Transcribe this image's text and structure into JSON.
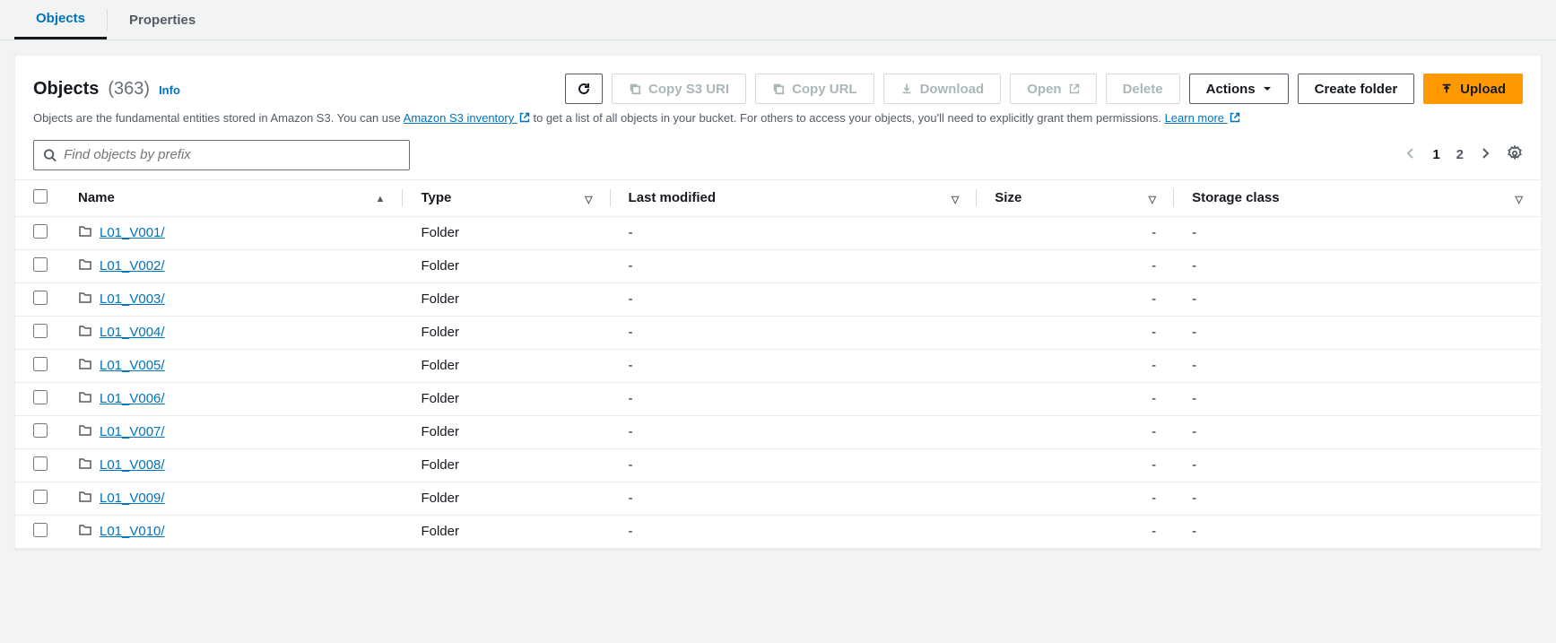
{
  "tabs": {
    "objects": "Objects",
    "properties": "Properties"
  },
  "header": {
    "title": "Objects",
    "count": "(363)",
    "info": "Info"
  },
  "toolbar": {
    "copy_s3_uri": "Copy S3 URI",
    "copy_url": "Copy URL",
    "download": "Download",
    "open": "Open",
    "delete": "Delete",
    "actions": "Actions",
    "create_folder": "Create folder",
    "upload": "Upload"
  },
  "description": {
    "pre": "Objects are the fundamental entities stored in Amazon S3. You can use ",
    "link1": "Amazon S3 inventory",
    "mid": " to get a list of all objects in your bucket. For others to access your objects, you'll need to explicitly grant them permissions. ",
    "link2": "Learn more"
  },
  "search": {
    "placeholder": "Find objects by prefix"
  },
  "pagination": {
    "page1": "1",
    "page2": "2"
  },
  "columns": {
    "name": "Name",
    "type": "Type",
    "last_modified": "Last modified",
    "size": "Size",
    "storage_class": "Storage class"
  },
  "rows": [
    {
      "name": "L01_V001/",
      "type": "Folder",
      "last_modified": "-",
      "size": "-",
      "storage_class": "-"
    },
    {
      "name": "L01_V002/",
      "type": "Folder",
      "last_modified": "-",
      "size": "-",
      "storage_class": "-"
    },
    {
      "name": "L01_V003/",
      "type": "Folder",
      "last_modified": "-",
      "size": "-",
      "storage_class": "-"
    },
    {
      "name": "L01_V004/",
      "type": "Folder",
      "last_modified": "-",
      "size": "-",
      "storage_class": "-"
    },
    {
      "name": "L01_V005/",
      "type": "Folder",
      "last_modified": "-",
      "size": "-",
      "storage_class": "-"
    },
    {
      "name": "L01_V006/",
      "type": "Folder",
      "last_modified": "-",
      "size": "-",
      "storage_class": "-"
    },
    {
      "name": "L01_V007/",
      "type": "Folder",
      "last_modified": "-",
      "size": "-",
      "storage_class": "-"
    },
    {
      "name": "L01_V008/",
      "type": "Folder",
      "last_modified": "-",
      "size": "-",
      "storage_class": "-"
    },
    {
      "name": "L01_V009/",
      "type": "Folder",
      "last_modified": "-",
      "size": "-",
      "storage_class": "-"
    },
    {
      "name": "L01_V010/",
      "type": "Folder",
      "last_modified": "-",
      "size": "-",
      "storage_class": "-"
    }
  ]
}
